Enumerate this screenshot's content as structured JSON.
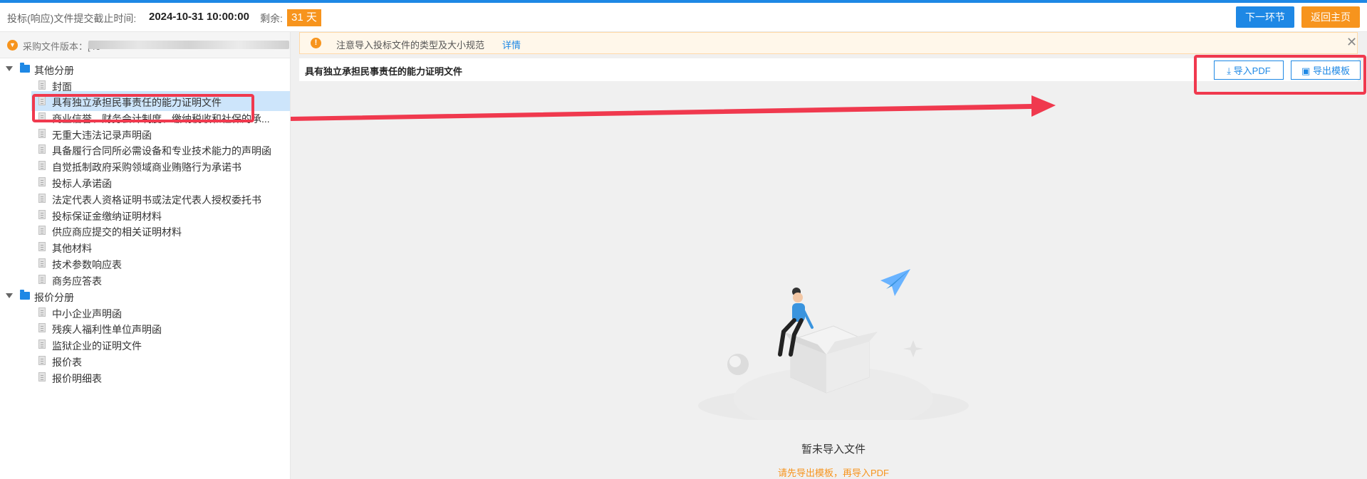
{
  "header": {
    "deadline_label": "投标(响应)文件提交截止时间:",
    "deadline_value": "2024-10-31 10:00:00",
    "remaining_label": "剩余:",
    "remaining_days": "31 天",
    "next_button": "下一环节",
    "home_button": "返回主页"
  },
  "sidebar": {
    "version_label": "采购文件版本：[46",
    "groups": [
      {
        "label": "其他分册",
        "items": [
          "封面",
          "具有独立承担民事责任的能力证明文件",
          "商业信誉、财务会计制度、缴纳税收和社保的承...",
          "无重大违法记录声明函",
          "具备履行合同所必需设备和专业技术能力的声明函",
          "自觉抵制政府采购领域商业贿赂行为承诺书",
          "投标人承诺函",
          "法定代表人资格证明书或法定代表人授权委托书",
          "投标保证金缴纳证明材料",
          "供应商应提交的相关证明材料",
          "其他材料",
          "技术参数响应表",
          "商务应答表"
        ]
      },
      {
        "label": "报价分册",
        "items": [
          "中小企业声明函",
          "残疾人福利性单位声明函",
          "监狱企业的证明文件",
          "报价表",
          "报价明细表"
        ]
      }
    ]
  },
  "main": {
    "notice_text": "注意导入投标文件的类型及大小规范",
    "notice_link": "详情",
    "notice_close": "✕",
    "doc_title": "具有独立承担民事责任的能力证明文件",
    "import_pdf": "导入PDF",
    "export_template": "导出模板",
    "empty_title": "暂未导入文件",
    "empty_sub": "请先导出模板，再导入PDF"
  },
  "colors": {
    "primary": "#1e88e5",
    "accent": "#f7941d",
    "highlight": "#f0394e",
    "selected_row": "#cde5fb"
  },
  "icons": {
    "version": "chevron-down-circle-icon",
    "notice": "exclamation-circle-icon",
    "import": "download-icon",
    "export": "save-icon"
  }
}
